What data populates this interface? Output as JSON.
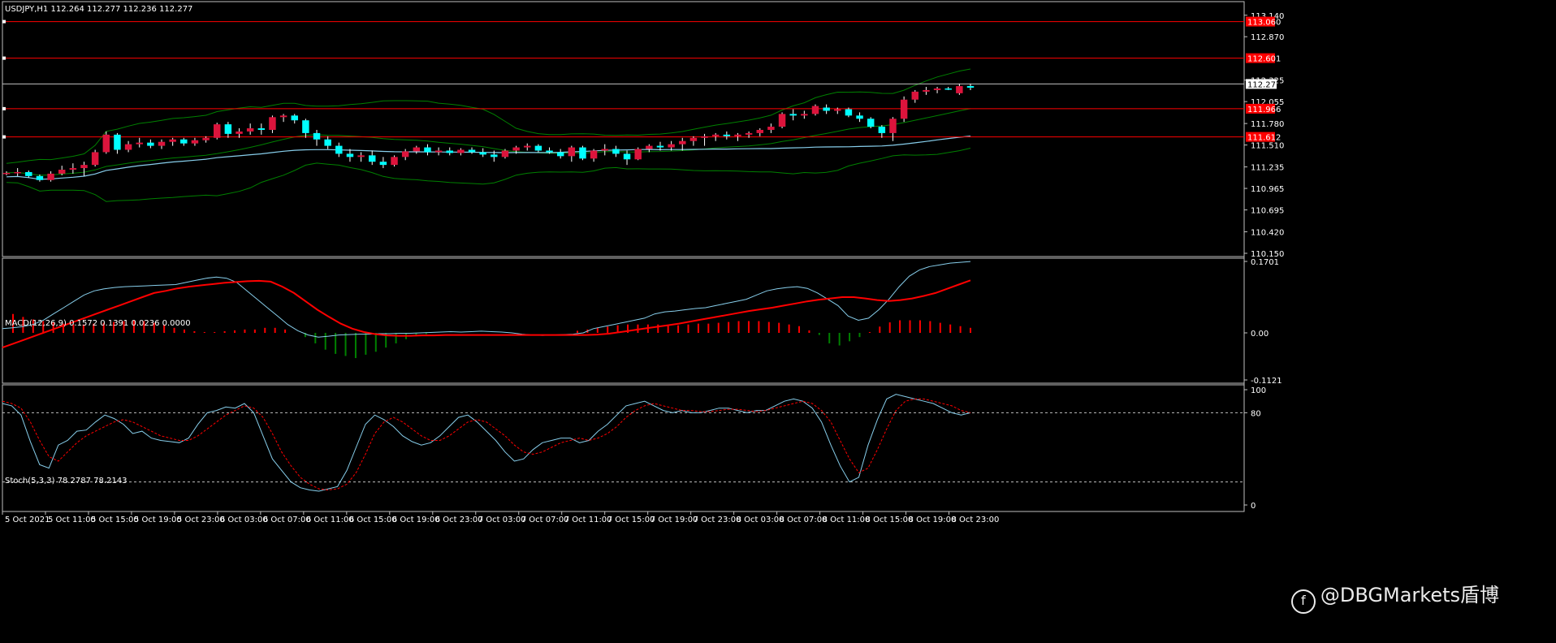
{
  "chart_data": [
    {
      "type": "candlestick",
      "title": "USDJPY,H1  112.264 112.277 112.236 112.277",
      "ylim": [
        110.15,
        113.27
      ],
      "yticks": [
        "113.140",
        "112.870",
        "112.325",
        "112.055",
        "111.780",
        "111.510",
        "111.235",
        "110.965",
        "110.695",
        "110.420",
        "110.150"
      ],
      "levels": [
        {
          "label": "113.060",
          "value": 113.06,
          "color": "#ff0000"
        },
        {
          "label": "112.601",
          "value": 112.601,
          "color": "#ff0000"
        },
        {
          "label": "111.966",
          "value": 111.966,
          "color": "#ff0000"
        },
        {
          "label": "111.612",
          "value": 111.612,
          "color": "#ff0000"
        }
      ],
      "current_price": {
        "label": "112.277",
        "value": 112.277
      },
      "candles": [
        [
          111.16,
          111.18,
          111.13,
          111.16
        ],
        [
          111.16,
          111.22,
          111.12,
          111.17
        ],
        [
          111.17,
          111.19,
          111.1,
          111.12
        ],
        [
          111.12,
          111.14,
          111.05,
          111.07
        ],
        [
          111.07,
          111.18,
          111.05,
          111.15
        ],
        [
          111.15,
          111.25,
          111.13,
          111.2
        ],
        [
          111.2,
          111.28,
          111.15,
          111.22
        ],
        [
          111.22,
          111.3,
          111.12,
          111.26
        ],
        [
          111.26,
          111.45,
          111.24,
          111.42
        ],
        [
          111.42,
          111.68,
          111.4,
          111.64
        ],
        [
          111.64,
          111.66,
          111.4,
          111.45
        ],
        [
          111.45,
          111.56,
          111.42,
          111.52
        ],
        [
          111.52,
          111.6,
          111.48,
          111.54
        ],
        [
          111.54,
          111.58,
          111.47,
          111.5
        ],
        [
          111.5,
          111.58,
          111.46,
          111.55
        ],
        [
          111.55,
          111.6,
          111.5,
          111.58
        ],
        [
          111.58,
          111.6,
          111.5,
          111.53
        ],
        [
          111.53,
          111.6,
          111.5,
          111.57
        ],
        [
          111.57,
          111.62,
          111.54,
          111.6
        ],
        [
          111.6,
          111.79,
          111.58,
          111.77
        ],
        [
          111.77,
          111.8,
          111.6,
          111.65
        ],
        [
          111.65,
          111.72,
          111.6,
          111.68
        ],
        [
          111.68,
          111.78,
          111.64,
          111.72
        ],
        [
          111.72,
          111.78,
          111.64,
          111.7
        ],
        [
          111.7,
          111.88,
          111.66,
          111.86
        ],
        [
          111.86,
          111.9,
          111.8,
          111.88
        ],
        [
          111.88,
          111.9,
          111.78,
          111.82
        ],
        [
          111.82,
          111.84,
          111.6,
          111.66
        ],
        [
          111.66,
          111.7,
          111.5,
          111.58
        ],
        [
          111.58,
          111.62,
          111.46,
          111.5
        ],
        [
          111.5,
          111.54,
          111.36,
          111.4
        ],
        [
          111.4,
          111.46,
          111.3,
          111.36
        ],
        [
          111.36,
          111.42,
          111.3,
          111.38
        ],
        [
          111.38,
          111.44,
          111.26,
          111.3
        ],
        [
          111.3,
          111.36,
          111.22,
          111.26
        ],
        [
          111.26,
          111.38,
          111.24,
          111.36
        ],
        [
          111.36,
          111.46,
          111.32,
          111.43
        ],
        [
          111.43,
          111.5,
          111.4,
          111.48
        ],
        [
          111.48,
          111.52,
          111.38,
          111.42
        ],
        [
          111.42,
          111.48,
          111.38,
          111.44
        ],
        [
          111.44,
          111.48,
          111.38,
          111.41
        ],
        [
          111.41,
          111.47,
          111.38,
          111.45
        ],
        [
          111.45,
          111.48,
          111.4,
          111.42
        ],
        [
          111.42,
          111.47,
          111.36,
          111.39
        ],
        [
          111.39,
          111.44,
          111.3,
          111.36
        ],
        [
          111.36,
          111.46,
          111.34,
          111.44
        ],
        [
          111.44,
          111.5,
          111.4,
          111.48
        ],
        [
          111.48,
          111.53,
          111.44,
          111.5
        ],
        [
          111.5,
          111.52,
          111.42,
          111.44
        ],
        [
          111.44,
          111.48,
          111.4,
          111.42
        ],
        [
          111.42,
          111.46,
          111.34,
          111.37
        ],
        [
          111.37,
          111.5,
          111.3,
          111.48
        ],
        [
          111.48,
          111.5,
          111.32,
          111.34
        ],
        [
          111.34,
          111.46,
          111.3,
          111.44
        ],
        [
          111.44,
          111.52,
          111.38,
          111.46
        ],
        [
          111.46,
          111.5,
          111.36,
          111.4
        ],
        [
          111.4,
          111.44,
          111.26,
          111.33
        ],
        [
          111.33,
          111.48,
          111.32,
          111.46
        ],
        [
          111.46,
          111.52,
          111.42,
          111.5
        ],
        [
          111.5,
          111.55,
          111.44,
          111.48
        ],
        [
          111.48,
          111.56,
          111.44,
          111.52
        ],
        [
          111.52,
          111.6,
          111.44,
          111.56
        ],
        [
          111.56,
          111.62,
          111.5,
          111.6
        ],
        [
          111.6,
          111.65,
          111.5,
          111.62
        ],
        [
          111.62,
          111.66,
          111.56,
          111.64
        ],
        [
          111.64,
          111.68,
          111.58,
          111.62
        ],
        [
          111.62,
          111.66,
          111.56,
          111.64
        ],
        [
          111.64,
          111.68,
          111.6,
          111.66
        ],
        [
          111.66,
          111.72,
          111.62,
          111.7
        ],
        [
          111.7,
          111.78,
          111.66,
          111.74
        ],
        [
          111.74,
          111.92,
          111.72,
          111.9
        ],
        [
          111.9,
          111.96,
          111.82,
          111.88
        ],
        [
          111.88,
          111.94,
          111.84,
          111.9
        ],
        [
          111.9,
          112.02,
          111.88,
          112.0
        ],
        [
          111.98,
          112.02,
          111.9,
          111.94
        ],
        [
          111.94,
          111.98,
          111.9,
          111.96
        ],
        [
          111.96,
          111.98,
          111.86,
          111.88
        ],
        [
          111.88,
          111.92,
          111.8,
          111.84
        ],
        [
          111.84,
          111.86,
          111.72,
          111.74
        ],
        [
          111.74,
          111.76,
          111.6,
          111.66
        ],
        [
          111.66,
          111.86,
          111.56,
          111.84
        ],
        [
          111.84,
          112.12,
          111.8,
          112.08
        ],
        [
          112.08,
          112.2,
          112.04,
          112.18
        ],
        [
          112.18,
          112.24,
          112.14,
          112.2
        ],
        [
          112.2,
          112.24,
          112.16,
          112.22
        ],
        [
          112.22,
          112.24,
          112.2,
          112.21
        ],
        [
          112.16,
          112.28,
          112.14,
          112.25
        ],
        [
          112.25,
          112.28,
          112.2,
          112.23
        ]
      ],
      "bollinger": {
        "color": "#008000"
      },
      "ma": {
        "color": "#87ceeb"
      }
    },
    {
      "type": "macd",
      "title": "MACD(12,26,9) 0.1572 0.1391 0.0236 0.0000",
      "yticks": [
        "0.1701",
        "0.00",
        "-0.1121"
      ],
      "ylim": [
        -0.1121,
        0.1701
      ],
      "macd": [
        0.01,
        0.012,
        0.015,
        0.02,
        0.03,
        0.045,
        0.06,
        0.075,
        0.09,
        0.1,
        0.105,
        0.108,
        0.11,
        0.111,
        0.112,
        0.113,
        0.114,
        0.115,
        0.12,
        0.125,
        0.13,
        0.133,
        0.13,
        0.12,
        0.1,
        0.08,
        0.06,
        0.04,
        0.02,
        0.005,
        -0.005,
        -0.01,
        -0.008,
        -0.005,
        -0.004,
        -0.003,
        -0.003,
        -0.002,
        -0.002,
        -0.001,
        -0.001,
        0.0,
        0.001,
        0.002,
        0.003,
        0.002,
        0.003,
        0.004,
        0.003,
        0.002,
        0.0,
        -0.003,
        -0.005,
        -0.006,
        -0.005,
        -0.004,
        -0.003,
        0.0,
        0.01,
        0.015,
        0.02,
        0.025,
        0.03,
        0.035,
        0.045,
        0.05,
        0.052,
        0.055,
        0.058,
        0.06,
        0.065,
        0.07,
        0.075,
        0.08,
        0.09,
        0.1,
        0.105,
        0.108,
        0.11,
        0.106,
        0.095,
        0.08,
        0.065,
        0.04,
        0.03,
        0.035,
        0.055,
        0.08,
        0.11,
        0.135,
        0.15,
        0.158,
        0.162,
        0.166,
        0.168,
        0.17
      ],
      "signal": [
        -0.035,
        -0.025,
        -0.015,
        -0.005,
        0.005,
        0.015,
        0.025,
        0.035,
        0.045,
        0.055,
        0.065,
        0.075,
        0.085,
        0.095,
        0.1,
        0.106,
        0.11,
        0.113,
        0.116,
        0.119,
        0.121,
        0.123,
        0.124,
        0.122,
        0.11,
        0.095,
        0.075,
        0.055,
        0.038,
        0.022,
        0.01,
        0.002,
        -0.003,
        -0.006,
        -0.007,
        -0.007,
        -0.006,
        -0.006,
        -0.005,
        -0.005,
        -0.005,
        -0.005,
        -0.005,
        -0.005,
        -0.005,
        -0.005,
        -0.005,
        -0.005,
        -0.005,
        -0.005,
        -0.005,
        -0.004,
        -0.002,
        0.002,
        0.006,
        0.01,
        0.014,
        0.018,
        0.022,
        0.027,
        0.032,
        0.037,
        0.042,
        0.047,
        0.052,
        0.056,
        0.06,
        0.065,
        0.07,
        0.075,
        0.079,
        0.082,
        0.085,
        0.085,
        0.082,
        0.078,
        0.076,
        0.078,
        0.082,
        0.088,
        0.095,
        0.105,
        0.115,
        0.125
      ],
      "histogram": [
        0.045,
        0.038,
        0.032,
        0.028,
        0.025,
        0.022,
        0.02,
        0.02,
        0.022,
        0.024,
        0.026,
        0.028,
        0.03,
        0.028,
        0.024,
        0.02,
        0.012,
        0.008,
        0.004,
        0.002,
        0.002,
        0.004,
        0.006,
        0.008,
        0.008,
        0.012,
        0.012,
        0.008,
        0.0,
        -0.01,
        -0.025,
        -0.04,
        -0.05,
        -0.055,
        -0.06,
        -0.052,
        -0.045,
        -0.035,
        -0.025,
        -0.015,
        -0.008,
        -0.003,
        0.0,
        0.0,
        0.0,
        0.0,
        0.0,
        0.0,
        0.0,
        0.0,
        0.0,
        0.0,
        0.0,
        0.0,
        0.0,
        0.0,
        0.005,
        0.008,
        0.012,
        0.015,
        0.018,
        0.02,
        0.02,
        0.02,
        0.02,
        0.018,
        0.018,
        0.02,
        0.022,
        0.022,
        0.024,
        0.026,
        0.028,
        0.028,
        0.028,
        0.026,
        0.024,
        0.02,
        0.016,
        0.006,
        -0.005,
        -0.025,
        -0.03,
        -0.02,
        -0.01,
        0.002,
        0.015,
        0.025,
        0.03,
        0.03,
        0.03,
        0.028,
        0.024,
        0.02,
        0.016,
        0.012
      ],
      "colors": {
        "macd": "#87ceeb",
        "signal": "#ff0000",
        "hist_pos": "#ff0000",
        "hist_neg": "#008000"
      }
    },
    {
      "type": "stochastic",
      "title": "Stoch(5,3,3) 78.2787 78.2143",
      "yticks": [
        "100",
        "80",
        "0"
      ],
      "ylim": [
        0,
        100
      ],
      "levels": [
        80,
        20
      ],
      "k": [
        88,
        86,
        78,
        55,
        35,
        32,
        52,
        56,
        64,
        65,
        72,
        78,
        75,
        70,
        62,
        64,
        58,
        56,
        55,
        54,
        58,
        70,
        80,
        82,
        85,
        84,
        88,
        80,
        60,
        40,
        30,
        20,
        15,
        13,
        12,
        14,
        16,
        30,
        50,
        70,
        78,
        74,
        68,
        60,
        55,
        52,
        54,
        60,
        68,
        76,
        78,
        72,
        64,
        56,
        46,
        38,
        40,
        48,
        54,
        56,
        58,
        58,
        54,
        56,
        64,
        70,
        78,
        86,
        88,
        90,
        86,
        82,
        80,
        82,
        80,
        80,
        82,
        84,
        84,
        82,
        80,
        82,
        82,
        86,
        90,
        92,
        90,
        84,
        72,
        52,
        34,
        20,
        24,
        52,
        74,
        92,
        96,
        94,
        92,
        90,
        88,
        84,
        80,
        78,
        80
      ],
      "d": [
        90,
        88,
        84,
        72,
        56,
        42,
        38,
        46,
        54,
        60,
        64,
        68,
        72,
        74,
        72,
        68,
        64,
        60,
        58,
        56,
        56,
        60,
        66,
        72,
        78,
        82,
        86,
        84,
        76,
        62,
        46,
        34,
        24,
        18,
        14,
        13,
        14,
        18,
        28,
        44,
        62,
        72,
        76,
        72,
        66,
        60,
        56,
        56,
        60,
        66,
        72,
        74,
        72,
        66,
        60,
        52,
        46,
        44,
        46,
        50,
        54,
        56,
        58,
        56,
        58,
        62,
        68,
        76,
        82,
        86,
        88,
        86,
        84,
        82,
        82,
        81,
        81,
        82,
        83,
        83,
        82,
        81,
        82,
        84,
        86,
        88,
        90,
        88,
        82,
        72,
        56,
        40,
        28,
        32,
        48,
        66,
        82,
        90,
        92,
        92,
        90,
        88,
        86,
        82,
        80
      ],
      "colors": {
        "k": "#87ceeb",
        "d": "#ff0000"
      }
    }
  ],
  "x_labels": [
    "5 Oct 2021",
    "5 Oct 11:00",
    "5 Oct 15:00",
    "5 Oct 19:00",
    "5 Oct 23:00",
    "6 Oct 03:00",
    "6 Oct 07:00",
    "6 Oct 11:00",
    "6 Oct 15:00",
    "6 Oct 19:00",
    "6 Oct 23:00",
    "7 Oct 03:00",
    "7 Oct 07:00",
    "7 Oct 11:00",
    "7 Oct 15:00",
    "7 Oct 19:00",
    "7 Oct 23:00",
    "8 Oct 03:00",
    "8 Oct 07:00",
    "8 Oct 11:00",
    "8 Oct 15:00",
    "8 Oct 19:00",
    "8 Oct 23:00"
  ],
  "watermark": "@DBGMarkets盾博",
  "colors": {
    "bg": "#000000",
    "frame": "#c0c0c0",
    "bull": "#dc143c",
    "bear": "#00ffff",
    "level": "#ff0000"
  }
}
